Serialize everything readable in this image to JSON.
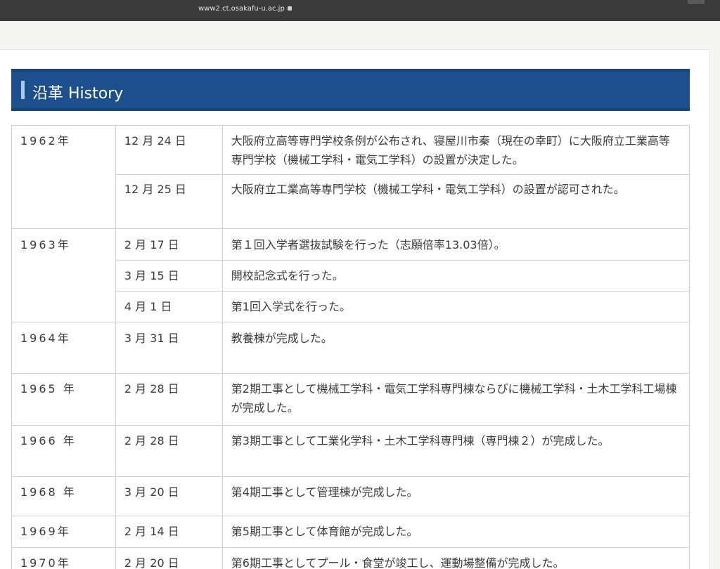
{
  "browser": {
    "url": "www2.ct.osakafu-u.ac.jp",
    "lock_icon": "lock-icon"
  },
  "heading": {
    "title": "沿革 History"
  },
  "history": {
    "rows": [
      {
        "year": "1962年",
        "date": "12 月 24 日",
        "event": "大阪府立高等専門学校条例が公布され、寝屋川市秦（現在の幸町）に大阪府立工業高等専門学校（機械工学科・電気工学科）の設置が決定した。"
      },
      {
        "year": "",
        "date": "12 月 25 日",
        "event": "大阪府立工業高等専門学校（機械工学科・電気工学科）の設置が認可された。"
      },
      {
        "year": "1963年",
        "date": "2 月 17 日",
        "event": "第１回入学者選抜試験を行った（志願倍率13.03倍）。"
      },
      {
        "year": "",
        "date": "3 月 15 日",
        "event": "開校記念式を行った。"
      },
      {
        "year": "",
        "date": "4 月 1 日",
        "event": "第1回入学式を行った。"
      },
      {
        "year": "1964年",
        "date": "3 月 31 日",
        "event": "教養棟が完成した。"
      },
      {
        "year": "1965 年",
        "date": "2 月 28 日",
        "event": "第2期工事として機械工学科・電気工学科専門棟ならびに機械工学科・土木工学科工場棟が完成した。"
      },
      {
        "year": "1966 年",
        "date": "2 月 28 日",
        "event": "第3期工事として工業化学科・土木工学科専門棟（専門棟２）が完成した。"
      },
      {
        "year": "1968 年",
        "date": "3 月 20 日",
        "event": "第4期工事として管理棟が完成した。"
      },
      {
        "year": "1969年",
        "date": "2 月 14 日",
        "event": "第5期工事として体育館が完成した。"
      },
      {
        "year": "1970年",
        "date": "2 月 20 日",
        "event": "第6期工事としてプール・食堂が竣工し、運動場整備が完成した。"
      }
    ]
  }
}
